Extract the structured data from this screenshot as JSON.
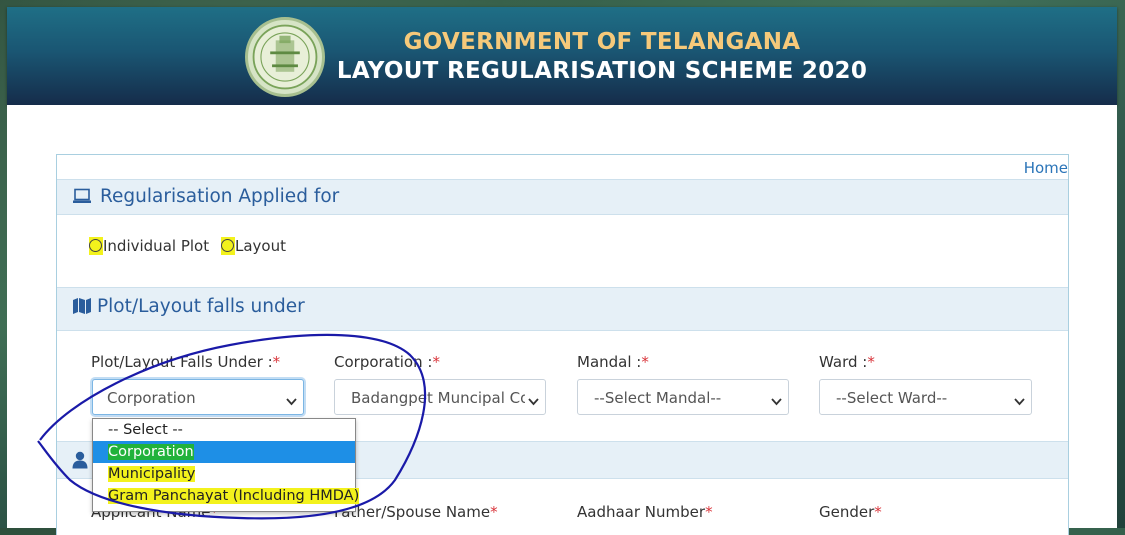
{
  "header": {
    "gov_title": "GOVERNMENT OF TELANGANA",
    "scheme_title": "LAYOUT REGULARISATION SCHEME 2020",
    "emblem_icon": "telangana-emblem"
  },
  "nav": {
    "home": "Home"
  },
  "regularisation": {
    "heading": "Regularisation Applied for",
    "icon": "laptop-icon",
    "options": [
      "Individual Plot",
      "Layout"
    ]
  },
  "plot": {
    "heading": "Plot/Layout falls under",
    "icon": "map-icon",
    "fields": [
      {
        "label": "Plot/Layout Falls Under :",
        "value": "Corporation"
      },
      {
        "label": "Corporation :",
        "value": "Badangpet Muncipal Co"
      },
      {
        "label": "Mandal :",
        "value": "--Select Mandal--"
      },
      {
        "label": "Ward :",
        "value": "--Select Ward--"
      }
    ],
    "required_mark": "*"
  },
  "dropdown": {
    "options": [
      "-- Select --",
      "Corporation",
      "Municipality",
      "Gram Panchayat (Including HMDA)"
    ],
    "selected_index": 1
  },
  "applicant": {
    "icon": "user-icon",
    "fields": [
      "Applicant Name",
      "Father/Spouse Name",
      "Aadhaar Number",
      "Gender"
    ]
  },
  "colors": {
    "header_top": "#1f6f86",
    "header_bottom": "#152c4a",
    "highlight": "#f3f21c",
    "selected_bg": "#1e8fe6",
    "heading_text": "#2a5d9c",
    "annotation": "#1a1aa8"
  }
}
